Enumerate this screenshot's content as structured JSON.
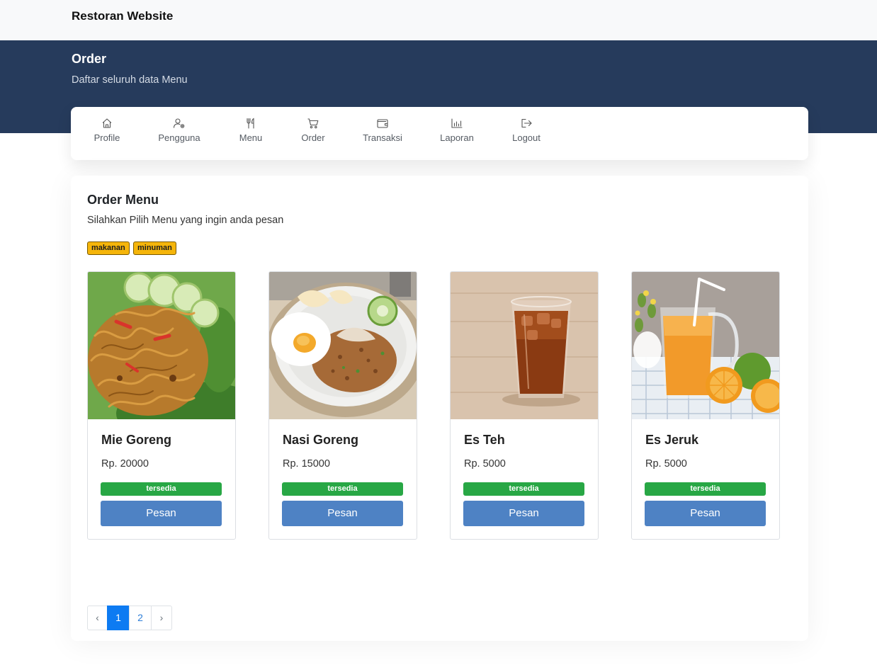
{
  "app": {
    "brand": "Restoran Website"
  },
  "header": {
    "title": "Order",
    "subtitle": "Daftar seluruh data Menu"
  },
  "nav": {
    "items": [
      {
        "label": "Profile",
        "icon": "home-icon"
      },
      {
        "label": "Pengguna",
        "icon": "users-gear-icon"
      },
      {
        "label": "Menu",
        "icon": "utensils-icon"
      },
      {
        "label": "Order",
        "icon": "cart-icon"
      },
      {
        "label": "Transaksi",
        "icon": "wallet-icon"
      },
      {
        "label": "Laporan",
        "icon": "bar-chart-icon"
      },
      {
        "label": "Logout",
        "icon": "logout-icon"
      }
    ]
  },
  "main": {
    "title": "Order Menu",
    "subtitle": "Silahkan Pilih Menu yang ingin anda pesan",
    "categories": [
      "makanan",
      "minuman"
    ],
    "products": [
      {
        "name": "Mie Goreng",
        "price": "Rp. 20000",
        "status": "tersedia",
        "button": "Pesan"
      },
      {
        "name": "Nasi Goreng",
        "price": "Rp. 15000",
        "status": "tersedia",
        "button": "Pesan"
      },
      {
        "name": "Es Teh",
        "price": "Rp. 5000",
        "status": "tersedia",
        "button": "Pesan"
      },
      {
        "name": "Es Jeruk",
        "price": "Rp. 5000",
        "status": "tersedia",
        "button": "Pesan"
      }
    ],
    "pagination": {
      "prev": "‹",
      "pages": [
        "1",
        "2"
      ],
      "current": "1",
      "next": "›"
    }
  },
  "colors": {
    "header_bg": "#263b5c",
    "tag_bg": "#f5b50a",
    "status_green": "#28a745",
    "button_blue": "#4e82c4",
    "page_active": "#0d7bf2"
  }
}
